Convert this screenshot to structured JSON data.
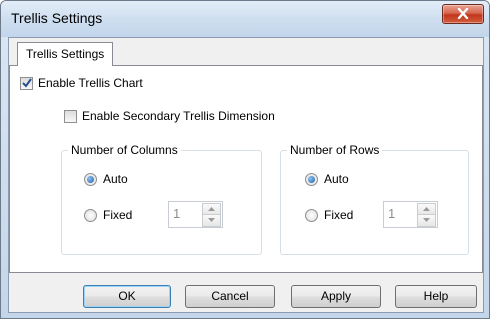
{
  "window": {
    "title": "Trellis Settings"
  },
  "tab": {
    "label": "Trellis Settings"
  },
  "enable_trellis": {
    "label": "Enable Trellis Chart",
    "checked": true
  },
  "enable_secondary": {
    "label": "Enable Secondary Trellis Dimension",
    "checked": false
  },
  "columns": {
    "legend": "Number of Columns",
    "auto_label": "Auto",
    "fixed_label": "Fixed",
    "selected": "Auto",
    "fixed_value": "1"
  },
  "rows": {
    "legend": "Number of Rows",
    "auto_label": "Auto",
    "fixed_label": "Fixed",
    "selected": "Auto",
    "fixed_value": "1"
  },
  "buttons": {
    "ok": "OK",
    "cancel": "Cancel",
    "apply": "Apply",
    "help": "Help"
  },
  "icons": {
    "close": "close-icon",
    "check": "checkmark-icon",
    "up": "arrow-up-icon",
    "down": "arrow-down-icon"
  }
}
